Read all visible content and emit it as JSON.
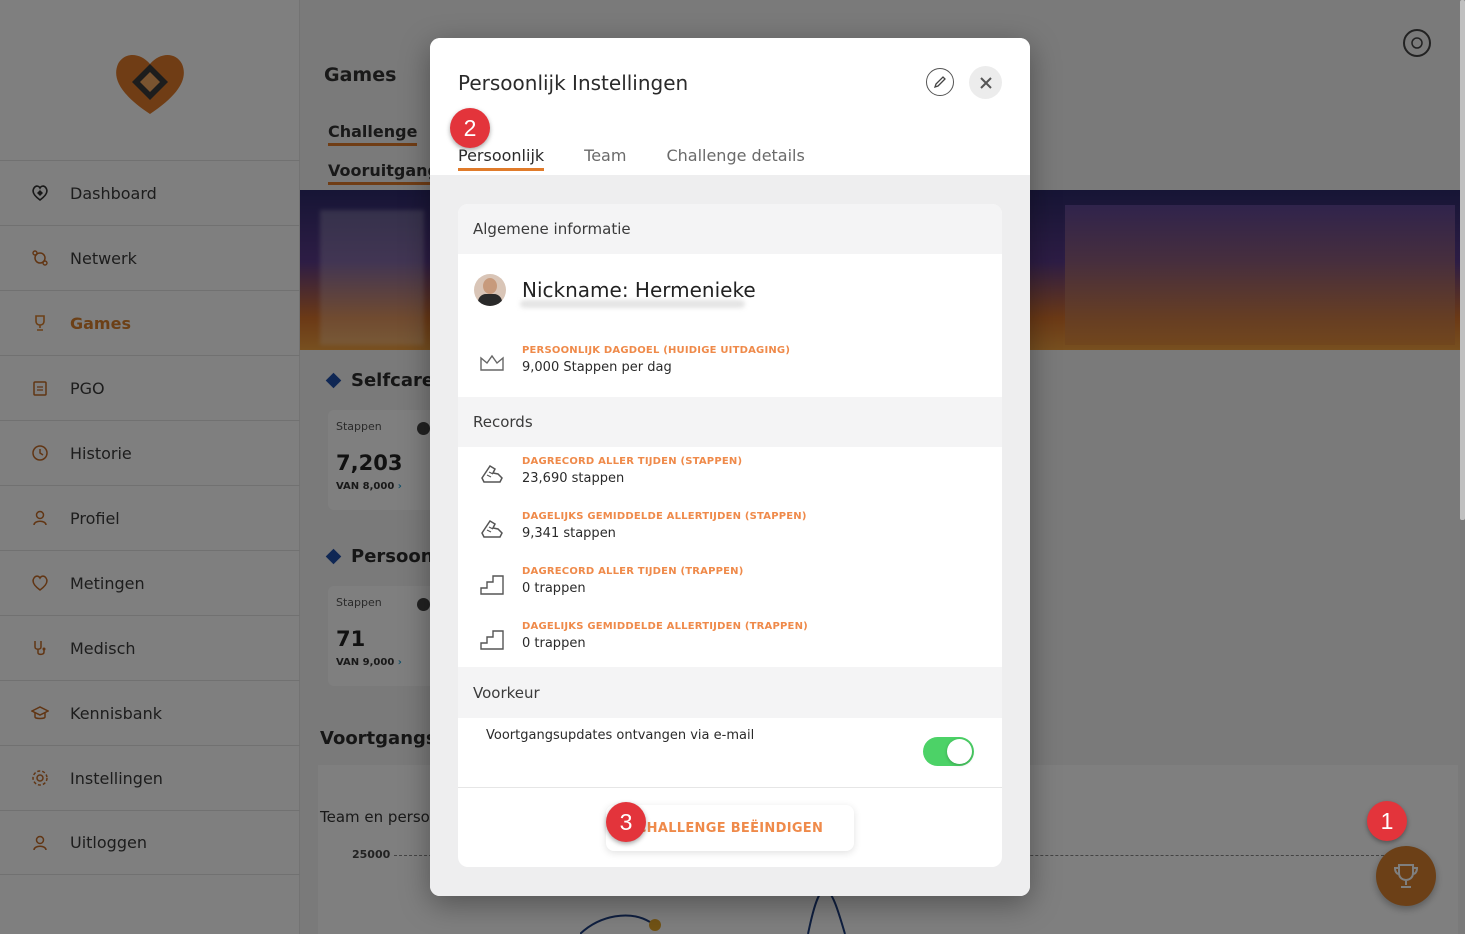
{
  "sidebar": {
    "items": [
      {
        "label": "Dashboard",
        "icon": "dashboard-icon"
      },
      {
        "label": "Netwerk",
        "icon": "network-icon"
      },
      {
        "label": "Games",
        "icon": "trophy-icon",
        "active": true
      },
      {
        "label": "PGO",
        "icon": "clipboard-icon"
      },
      {
        "label": "Historie",
        "icon": "history-icon"
      },
      {
        "label": "Profiel",
        "icon": "user-icon"
      },
      {
        "label": "Metingen",
        "icon": "heart-icon"
      },
      {
        "label": "Medisch",
        "icon": "stethoscope-icon"
      },
      {
        "label": "Kennisbank",
        "icon": "graduation-cap-icon"
      },
      {
        "label": "Instellingen",
        "icon": "gear-icon"
      },
      {
        "label": "Uitloggen",
        "icon": "logout-user-icon"
      }
    ]
  },
  "main": {
    "title": "Games",
    "subtabs": [
      "Challenge",
      "Vooruitgang"
    ],
    "sections": [
      {
        "title": "Selfcare (",
        "card": {
          "label": "Stappen",
          "value": "7,203",
          "of_label": "VAN 8,000"
        }
      },
      {
        "title": "Persoonli",
        "card": {
          "label": "Stappen",
          "value": "71",
          "of_label": "VAN 9,000"
        }
      }
    ],
    "progress_title": "Voortgangso",
    "chart_title": "Team en perso",
    "y_tick": "25000"
  },
  "modal": {
    "title": "Persoonlijk Instellingen",
    "tabs": [
      "Persoonlijk",
      "Team",
      "Challenge details"
    ],
    "active_tab": "Persoonlijk",
    "general_header": "Algemene informatie",
    "nickname": "Nickname: Hermenieke",
    "daily_goal": {
      "label": "PERSOONLIJK DAGDOEL (HUIDIGE UITDAGING)",
      "value": "9,000 Stappen per dag"
    },
    "records_header": "Records",
    "records": [
      {
        "label": "DAGRECORD ALLER TIJDEN (STAPPEN)",
        "value": "23,690 stappen",
        "icon": "shoe-icon"
      },
      {
        "label": "DAGELIJKS GEMIDDELDE ALLERTIJDEN (STAPPEN)",
        "value": "9,341 stappen",
        "icon": "shoe-icon"
      },
      {
        "label": "DAGRECORD ALLER TIJDEN (TRAPPEN)",
        "value": "0 trappen",
        "icon": "stairs-icon"
      },
      {
        "label": "DAGELIJKS GEMIDDELDE ALLERTIJDEN (TRAPPEN)",
        "value": "0 trappen",
        "icon": "stairs-icon"
      }
    ],
    "preference_header": "Voorkeur",
    "preference_label": "Voortgangsupdates ontvangen via e-mail",
    "preference_on": true,
    "end_button": "CHALLENGE BEËINDIGEN"
  },
  "annotations": [
    "1",
    "2",
    "3"
  ],
  "colors": {
    "accent": "#e07b2a",
    "label_orange": "#ef8a4a",
    "toggle_on": "#4cd267",
    "badge_red": "#e3343b"
  }
}
